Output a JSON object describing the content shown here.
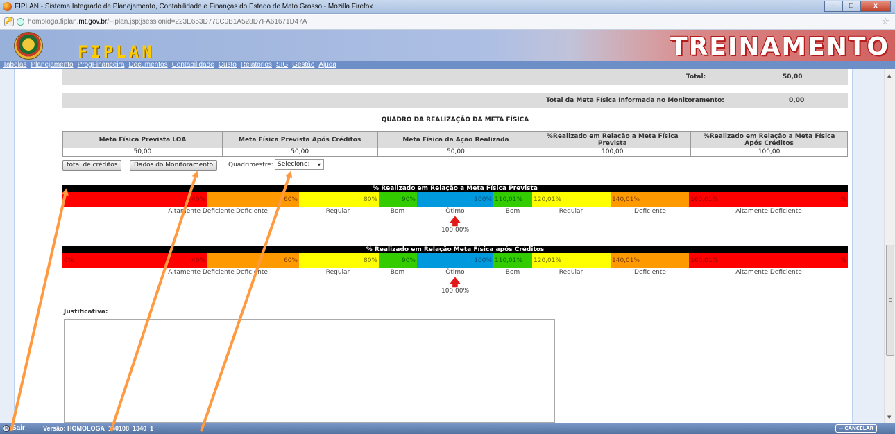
{
  "browser": {
    "window_title": "FIPLAN - Sistema Integrado de Planejamento, Contabilidade e Finanças do Estado de Mato Grosso - Mozilla Firefox",
    "url_prefix": "homologa.fiplan.",
    "url_domain": "mt.gov.br",
    "url_path": "/Fiplan.jsp;jsessionid=223E653D770C0B1A528D7FA61671D47A",
    "min_label": "–",
    "max_label": "□",
    "close_label": "x"
  },
  "banner": {
    "logo_text": "FIPLAN",
    "environment_label": "TREINAMENTO"
  },
  "menu": {
    "items": [
      "Tabelas",
      "Planejamento",
      "ProgFinanceira",
      "Documentos",
      "Contabilidade",
      "Custo",
      "Relatórios",
      "SIG",
      "Gestão",
      "Ajuda"
    ]
  },
  "totals": {
    "total_label": "Total:",
    "total_value": "50,00",
    "meta_informada_label": "Total da Meta Física Informada no Monitoramento:",
    "meta_informada_value": "0,00"
  },
  "quadro": {
    "title": "QUADRO DA REALIZAÇÃO DA META FÍSICA",
    "headers": [
      "Meta Física Prevista LOA",
      "Meta Física Prevista Após Créditos",
      "Meta Física da Ação Realizada",
      "%Realizado em Relação a Meta Física Prevista",
      "%Realizado em Relação a Meta Física Após Créditos"
    ],
    "values": [
      "50,00",
      "50,00",
      "50,00",
      "100,00",
      "100,00"
    ]
  },
  "actions": {
    "total_creditos_label": "total de créditos",
    "dados_monitoramento_label": "Dados do Monitoramento",
    "quadrimestre_label": "Quadrimestre:",
    "quadrimestre_selected": "Selecione:"
  },
  "perf1": {
    "title": "% Realizado em Relação a Meta Física Prevista",
    "segments": [
      {
        "left": "",
        "right": "40%"
      },
      {
        "left": "",
        "right": "60%"
      },
      {
        "left": "",
        "right": "80%"
      },
      {
        "left": "",
        "right": "90%"
      },
      {
        "left": "",
        "right": "100%"
      },
      {
        "left": "110,01%",
        "right": ""
      },
      {
        "left": "120,01%",
        "right": ""
      },
      {
        "left": "140,01%",
        "right": ""
      },
      {
        "left": "160,01%",
        "right": "%"
      }
    ],
    "labels": [
      "Altamente Deficiente",
      "Deficiente",
      "Regular",
      "Bom",
      "Ótimo",
      "Bom",
      "Regular",
      "Deficiente",
      "Altamente Deficiente"
    ],
    "marker_value": "100,00%"
  },
  "perf2": {
    "title": "% Realizado em Relação Meta Física após Créditos",
    "segments": [
      {
        "left": "0%",
        "right": "40%"
      },
      {
        "left": "",
        "right": "60%"
      },
      {
        "left": "",
        "right": "80%"
      },
      {
        "left": "",
        "right": "90%"
      },
      {
        "left": "",
        "right": "100%"
      },
      {
        "left": "110,01%",
        "right": ""
      },
      {
        "left": "120,01%",
        "right": ""
      },
      {
        "left": "140,01%",
        "right": ""
      },
      {
        "left": "160,01%",
        "right": "%"
      }
    ],
    "labels": [
      "Altamente Deficiente",
      "Deficiente",
      "Regular",
      "Bom",
      "Ótimo",
      "Bom",
      "Regular",
      "Deficiente",
      "Altamente Deficiente"
    ],
    "marker_value": "100,00%"
  },
  "justificativa": {
    "label": "Justificativa:",
    "value": ""
  },
  "status": {
    "sair_label": "Sair",
    "versao_label": "Versão: HOMOLOGA_140108_1340_1",
    "cancelar_label": "→ CANCELAR"
  },
  "colors": {
    "red": "#ff0000",
    "orange": "#ff9900",
    "yellow": "#ffff00",
    "green": "#33cc00",
    "blue": "#0099dd",
    "annotation": "#ff9a40"
  }
}
